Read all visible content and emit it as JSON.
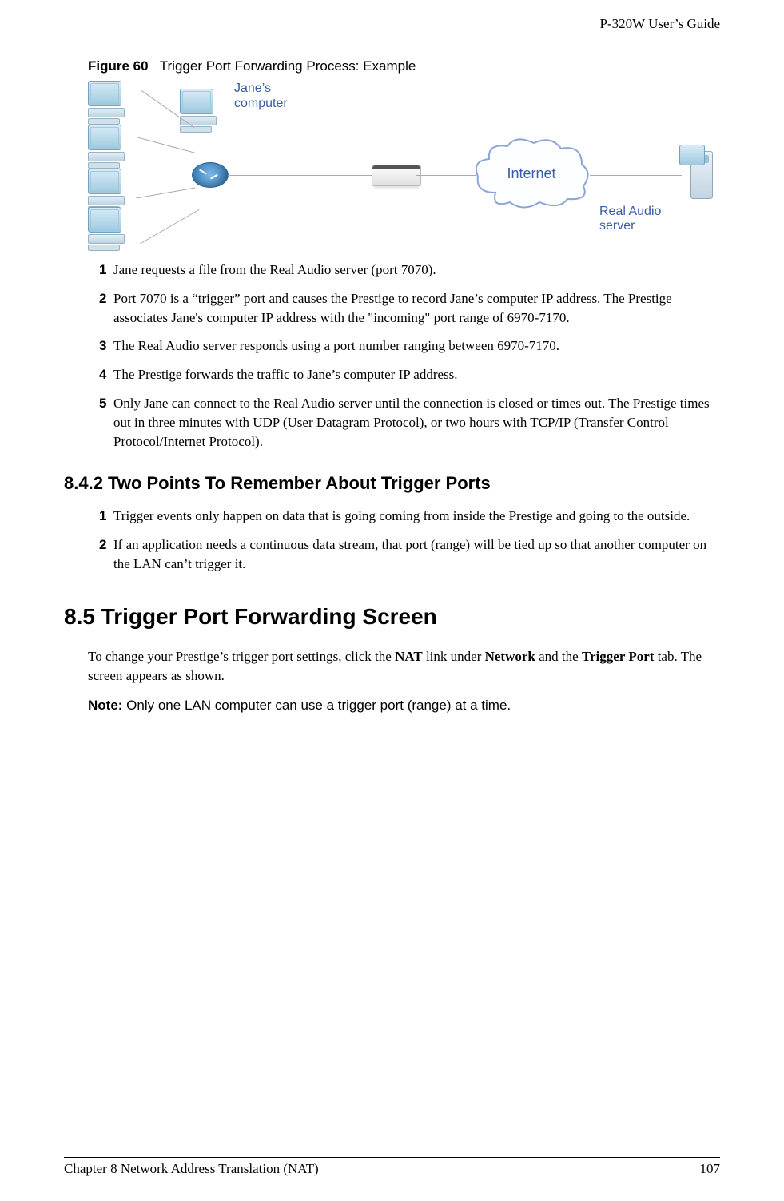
{
  "header": {
    "guide": "P-320W User’s Guide"
  },
  "figure": {
    "label": "Figure 60",
    "caption": "Trigger Port Forwarding Process: Example",
    "jane_label_line1": "Jane’s",
    "jane_label_line2": "computer",
    "cloud_label": "Internet",
    "server_label": "Real Audio server"
  },
  "steps1": [
    "Jane requests a file from the Real Audio server (port 7070).",
    "Port 7070 is a “trigger” port and causes the Prestige to record Jane’s computer IP address. The Prestige associates Jane's computer IP address with the \"incoming\" port range of 6970-7170.",
    "The Real Audio server responds using a port number ranging between 6970-7170.",
    "The Prestige forwards the traffic to Jane’s computer IP address.",
    "Only Jane can connect to the Real Audio server until the connection is closed or times out. The Prestige times out in three minutes with UDP (User Datagram Protocol), or two hours with TCP/IP (Transfer Control Protocol/Internet Protocol)."
  ],
  "section842": {
    "heading": "8.4.2  Two Points To Remember About Trigger Ports",
    "items": [
      "Trigger events only happen on data that is going coming from inside the Prestige and going to the outside.",
      "If an application needs a continuous data stream, that port (range) will be tied up so that another computer on the LAN can’t trigger it."
    ]
  },
  "section85": {
    "heading": "8.5  Trigger Port Forwarding Screen",
    "intro_pre": "To change your Prestige’s trigger port settings, click the ",
    "nat": "NAT",
    "intro_mid1": " link under ",
    "network": "Network",
    "intro_mid2": " and the ",
    "trigger_port": "Trigger Port",
    "intro_post": " tab. The screen appears as shown.",
    "note_label": "Note:",
    "note_text": " Only one LAN computer can use a trigger port (range) at a time."
  },
  "footer": {
    "chapter": "Chapter 8 Network Address Translation (NAT)",
    "page": "107"
  }
}
